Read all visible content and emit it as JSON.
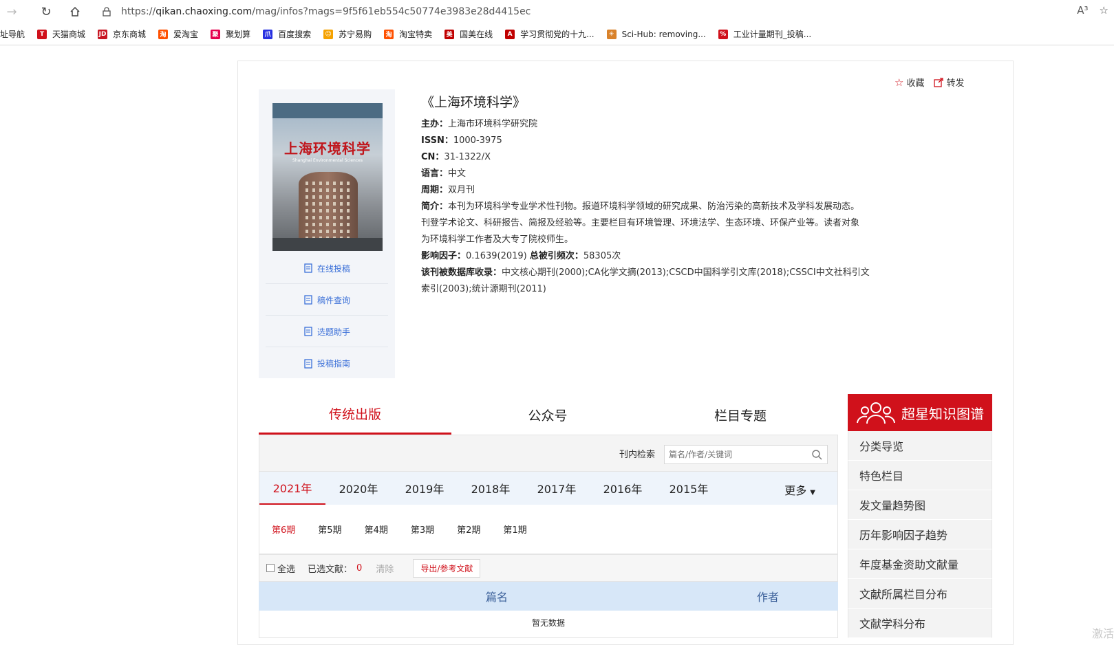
{
  "browser": {
    "url_prefix": "https://",
    "url_host": "qikan.chaoxing.com",
    "url_path": "/mag/infos?mags=9f5f61eb554c50774e3983e28d4415ec",
    "read_aloud": "A³",
    "bookmarks": [
      {
        "label": "址导航",
        "icon": "site-nav-icon",
        "color": ""
      },
      {
        "label": "天猫商城",
        "icon": "tmall-icon",
        "color": "#d0111b",
        "glyph": "T"
      },
      {
        "label": "京东商城",
        "icon": "jd-icon",
        "color": "#c81623",
        "glyph": "JD"
      },
      {
        "label": "爱淘宝",
        "icon": "aitaobao-icon",
        "color": "#ff5000",
        "glyph": "淘"
      },
      {
        "label": "聚划算",
        "icon": "juhuasuan-icon",
        "color": "#e5004f",
        "glyph": "聚"
      },
      {
        "label": "百度搜索",
        "icon": "baidu-icon",
        "color": "#2932e1",
        "glyph": "爪"
      },
      {
        "label": "苏宁易购",
        "icon": "suning-icon",
        "color": "#f5a200",
        "glyph": "☺"
      },
      {
        "label": "淘宝特卖",
        "icon": "taobao-special-icon",
        "color": "#ff5000",
        "glyph": "淘"
      },
      {
        "label": "国美在线",
        "icon": "gome-icon",
        "color": "#c00000",
        "glyph": "美"
      },
      {
        "label": "学习贯彻党的十九...",
        "icon": "cnki-icon",
        "color": "#c00000",
        "glyph": "A"
      },
      {
        "label": "Sci-Hub: removing...",
        "icon": "scihub-icon",
        "color": "#d9822b",
        "glyph": "✳"
      },
      {
        "label": "工业计量期刊_投稿...",
        "icon": "journal-icon",
        "color": "#d0111b",
        "glyph": "%"
      }
    ]
  },
  "journal": {
    "cover_title": "上海环境科学",
    "cover_subtitle": "Shanghai Environmental Sciences",
    "title": "《上海环境科学》",
    "fields": [
      {
        "label": "主办：",
        "value": "上海市环境科学研究院"
      },
      {
        "label": "ISSN：",
        "value": "1000-3975"
      },
      {
        "label": "CN：",
        "value": "31-1322/X"
      },
      {
        "label": "语言：",
        "value": "中文"
      },
      {
        "label": "周期：",
        "value": "双月刊"
      }
    ],
    "intro_label": "简介：",
    "intro_line1": "本刊为环境科学专业学术性刊物。报道环境科学领域的研究成果、防治污染的高新技术及学科发展动态。",
    "intro_line2": "刊登学术论文、科研报告、简报及经验等。主要栏目有环境管理、环境法学、生态环境、环保产业等。读者对象",
    "intro_line3": "为环境科学工作者及大专了院校师生。",
    "impact_label": "影响因子：",
    "impact_value": "0.1639(2019)",
    "citation_label": "总被引频次：",
    "citation_value": "58305次",
    "db_label": "该刊被数据库收录：",
    "db_line1": "中文核心期刊(2000);CA化学文摘(2013);CSCD中国科学引文库(2018);CSSCI中文社科引文",
    "db_line2": "索引(2003);统计源期刊(2011)",
    "favorite": "收藏",
    "share": "转发"
  },
  "side_links": [
    {
      "label": "在线投稿",
      "icon": "cloud-upload-icon"
    },
    {
      "label": "稿件查询",
      "icon": "document-search-icon"
    },
    {
      "label": "选题助手",
      "icon": "edit-icon"
    },
    {
      "label": "投稿指南",
      "icon": "guide-book-icon"
    }
  ],
  "tabs": [
    "传统出版",
    "公众号",
    "栏目专题"
  ],
  "search": {
    "label": "刊内检索",
    "placeholder": "篇名/作者/关键词"
  },
  "years": [
    "2021年",
    "2020年",
    "2019年",
    "2018年",
    "2017年",
    "2016年",
    "2015年"
  ],
  "more": "更多",
  "issues": [
    "第6期",
    "第5期",
    "第4期",
    "第3期",
    "第2期",
    "第1期"
  ],
  "selection": {
    "select_all": "全选",
    "selected_label": "已选文献：",
    "selected_count": "0",
    "clear": "清除",
    "export": "导出/参考文献"
  },
  "table": {
    "col_title": "篇名",
    "col_author": "作者",
    "empty": "暂无数据"
  },
  "knowledge_graph": {
    "title": "超星知识图谱",
    "items": [
      "分类导览",
      "特色栏目",
      "发文量趋势图",
      "历年影响因子趋势",
      "年度基金资助文献量",
      "文献所属栏目分布",
      "文献学科分布"
    ]
  },
  "watermark": "激活",
  "colors": {
    "accent": "#d0111b",
    "link": "#3a6fd8",
    "table_header": "#d7e7f8"
  }
}
